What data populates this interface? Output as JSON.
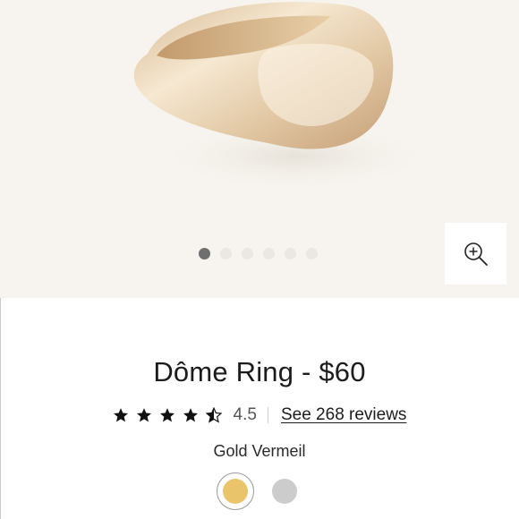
{
  "product": {
    "title": "Dôme Ring - $60",
    "rating": 4.5,
    "rating_label": "4.5",
    "reviews_label": "See 268 reviews",
    "variant_label": "Gold Vermeil"
  },
  "gallery": {
    "slide_count": 6,
    "active_slide": 1,
    "zoom_icon": "zoom-in-icon"
  },
  "swatches": [
    {
      "color": "#e9c46a",
      "selected": true
    },
    {
      "color": "#cccccc",
      "selected": false
    }
  ],
  "colors": {
    "hero_background": "#f7f4ef",
    "gold": "#e9c46a",
    "silver": "#cccccc",
    "text": "#1c1c1c"
  }
}
